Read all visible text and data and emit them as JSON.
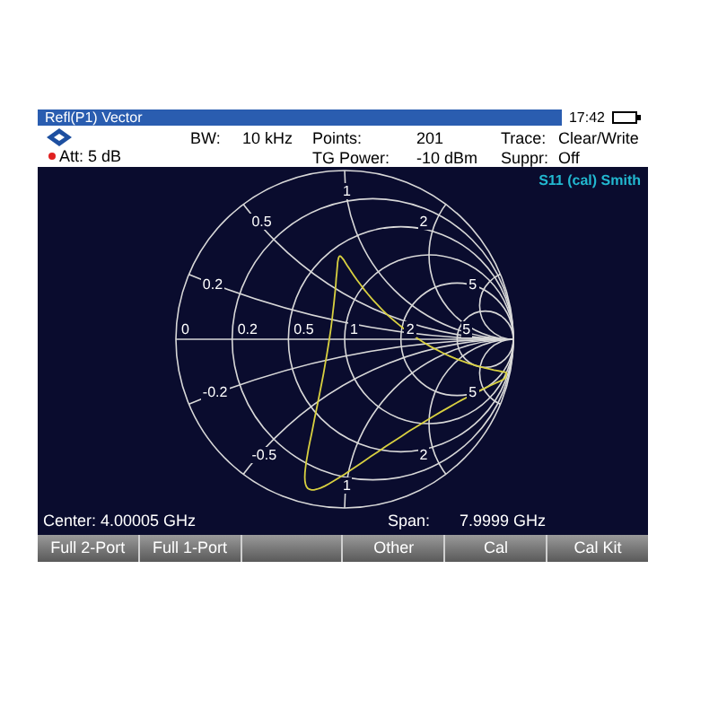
{
  "title_bar": {
    "title": "Refl(P1) Vector",
    "time": "17:42"
  },
  "header": {
    "att": "Att: 5 dB",
    "fields": [
      {
        "label": "BW:",
        "value": "10 kHz"
      },
      {
        "label": "Points:",
        "value": "201"
      },
      {
        "label": "Trace:",
        "value": "Clear/Write"
      },
      {
        "label": "TG Power:",
        "value": "-10 dBm"
      },
      {
        "label": "Suppr:",
        "value": "Off"
      }
    ]
  },
  "plot": {
    "trace_label": "S11 (cal) Smith",
    "real_axis_labels": [
      "0",
      "0.2",
      "0.5",
      "1",
      "2",
      "5"
    ],
    "reactance_labels": [
      "0.2",
      "0.5",
      "1",
      "2",
      "5",
      "-0.2",
      "-0.5",
      "1",
      "2",
      "5"
    ],
    "center": "Center: 4.00005 GHz",
    "span_label": "Span:",
    "span": "7.9999 GHz"
  },
  "softkeys": [
    {
      "kind": "label",
      "label": "Full 2-Port"
    },
    {
      "kind": "label",
      "label": "Full 1-Port"
    },
    {
      "kind": "blank"
    },
    {
      "kind": "label",
      "label": "Other"
    },
    {
      "kind": "label",
      "label": "Cal"
    },
    {
      "kind": "label",
      "label": "Cal Kit"
    }
  ]
}
